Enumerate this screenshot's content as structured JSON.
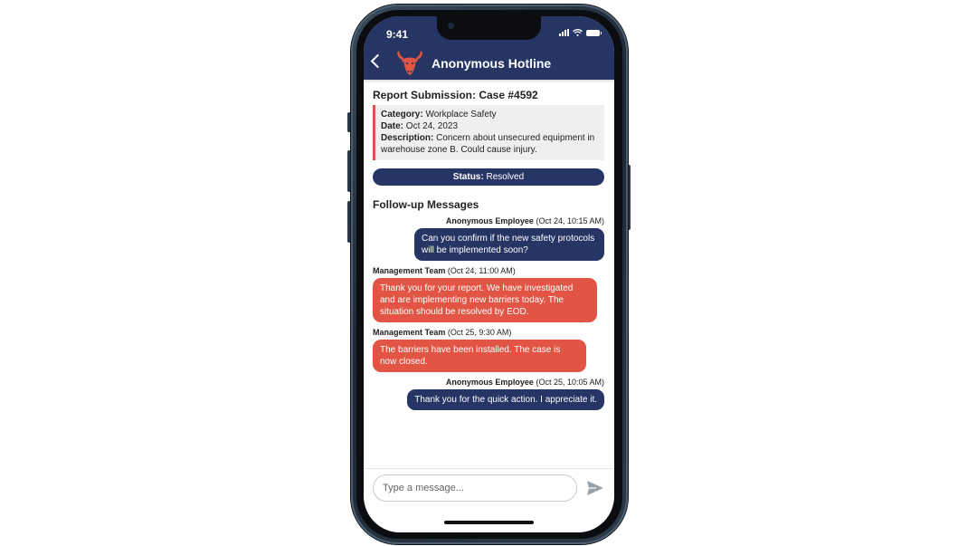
{
  "status_bar": {
    "time": "9:41"
  },
  "header": {
    "title": "Anonymous Hotline"
  },
  "report": {
    "title": "Report Submission: Case #4592",
    "category_label": "Category:",
    "category": "Workplace Safety",
    "date_label": "Date:",
    "date": "Oct 24, 2023",
    "description_label": "Description:",
    "description": "Concern about unsecured equipment in warehouse zone B. Could cause injury.",
    "status_label": "Status:",
    "status": "Resolved"
  },
  "followup": {
    "title": "Follow-up Messages",
    "messages": [
      {
        "sender": "Anonymous Employee",
        "time": "(Oct 24, 10:15 AM)",
        "text": "Can you confirm if the new safety protocols will be implemented soon?"
      },
      {
        "sender": "Management Team",
        "time": "(Oct 24, 11:00 AM)",
        "text": "Thank you for your report. We have investigated and are implementing new barriers today. The situation should be resolved by EOD."
      },
      {
        "sender": "Management Team",
        "time": "(Oct 25, 9:30 AM)",
        "text": "The barriers have been installed. The case is now closed."
      },
      {
        "sender": "Anonymous Employee",
        "time": "(Oct 25, 10:05 AM)",
        "text": "Thank you for the quick action. I appreciate it."
      }
    ]
  },
  "composer": {
    "placeholder": "Type a message..."
  },
  "colors": {
    "navy": "#263563",
    "red": "#e25545",
    "accent_border": "#d9534f",
    "card_bg": "#efeff1"
  },
  "icons": {
    "back": "chevron-left-icon",
    "logo": "bull-head-logo",
    "send": "send-icon",
    "signal": "signal-icon",
    "wifi": "wifi-icon",
    "battery": "battery-icon"
  }
}
